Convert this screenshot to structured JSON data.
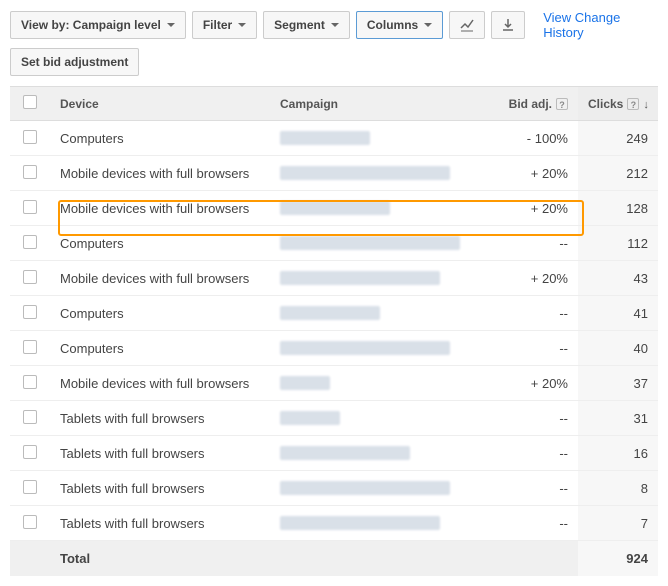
{
  "toolbar": {
    "view_by_label": "View by: Campaign level",
    "filter_label": "Filter",
    "segment_label": "Segment",
    "columns_label": "Columns",
    "history_link": "View Change History",
    "set_bid_label": "Set bid adjustment"
  },
  "table": {
    "headers": {
      "device": "Device",
      "campaign": "Campaign",
      "bid_adj": "Bid adj.",
      "clicks": "Clicks"
    },
    "rows": [
      {
        "device": "Computers",
        "bid_adj": "- 100%",
        "clicks": "249",
        "highlighted": true,
        "blur_w": 90
      },
      {
        "device": "Mobile devices with full browsers",
        "bid_adj": "+ 20%",
        "clicks": "212",
        "blur_w": 170
      },
      {
        "device": "Mobile devices with full browsers",
        "bid_adj": "+ 20%",
        "clicks": "128",
        "blur_w": 110
      },
      {
        "device": "Computers",
        "bid_adj": "--",
        "clicks": "112",
        "blur_w": 180
      },
      {
        "device": "Mobile devices with full browsers",
        "bid_adj": "+ 20%",
        "clicks": "43",
        "blur_w": 160
      },
      {
        "device": "Computers",
        "bid_adj": "--",
        "clicks": "41",
        "blur_w": 100
      },
      {
        "device": "Computers",
        "bid_adj": "--",
        "clicks": "40",
        "blur_w": 170
      },
      {
        "device": "Mobile devices with full browsers",
        "bid_adj": "+ 20%",
        "clicks": "37",
        "blur_w": 50
      },
      {
        "device": "Tablets with full browsers",
        "bid_adj": "--",
        "clicks": "31",
        "blur_w": 60
      },
      {
        "device": "Tablets with full browsers",
        "bid_adj": "--",
        "clicks": "16",
        "blur_w": 130
      },
      {
        "device": "Tablets with full browsers",
        "bid_adj": "--",
        "clicks": "8",
        "blur_w": 170
      },
      {
        "device": "Tablets with full browsers",
        "bid_adj": "--",
        "clicks": "7",
        "blur_w": 160
      }
    ],
    "footer": {
      "total_label": "Total",
      "total_clicks": "924"
    }
  }
}
